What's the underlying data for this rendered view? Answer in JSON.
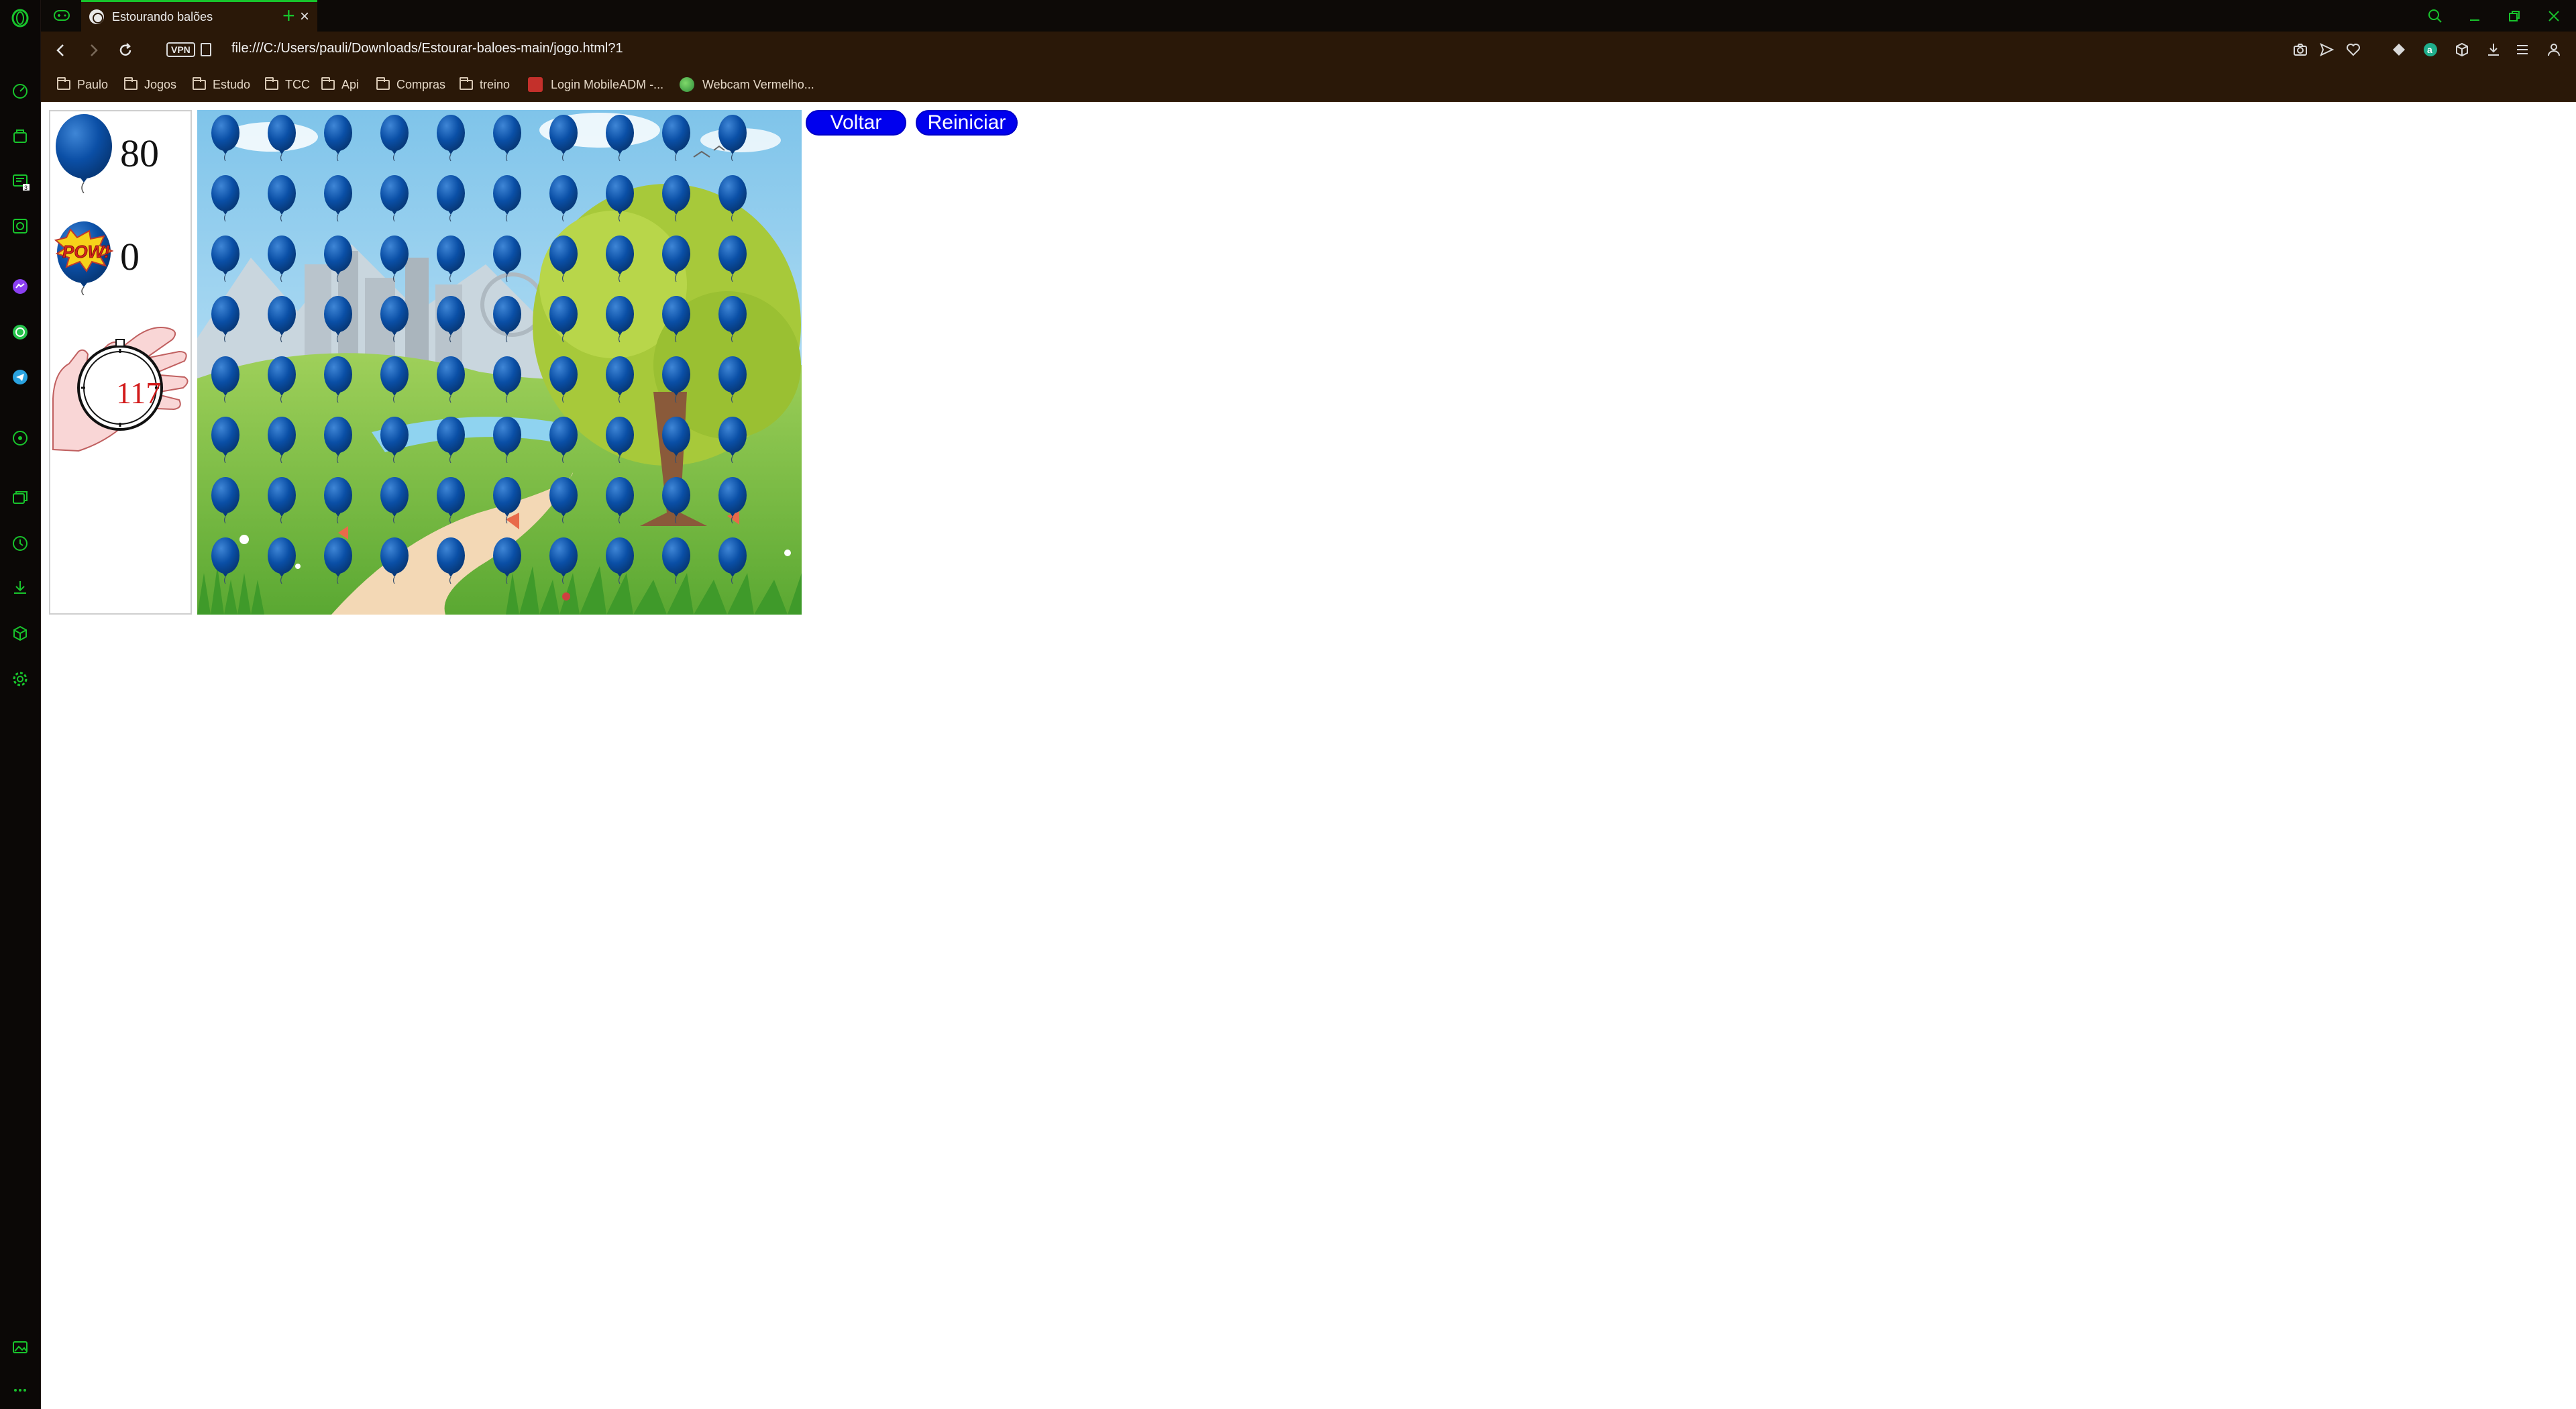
{
  "browser": {
    "tab_title": "Estourando balões",
    "url": "file:///C:/Users/pauli/Downloads/Estourar-baloes-main/jogo.html?1",
    "vpn_label": "VPN",
    "accent_color": "#18c42c",
    "bookmarks": [
      "Paulo",
      "Jogos",
      "Estudo",
      "TCC",
      "Api",
      "Compras",
      "treino",
      "Login MobileADM -...",
      "Webcam Vermelho..."
    ],
    "sidebar_badge": "3"
  },
  "hud": {
    "balloons_remaining": "80",
    "balloons_popped": "0",
    "pop_label": "POW!",
    "timer": "117"
  },
  "game": {
    "grid_columns": 10,
    "grid_rows": 8,
    "balloon_color": "#0a4fa6"
  },
  "buttons": {
    "voltar": "Voltar",
    "reiniciar": "Reiniciar"
  }
}
